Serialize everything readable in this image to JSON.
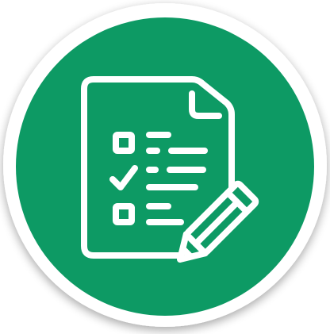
{
  "badge": {
    "icon": "checklist-with-pencil-icon",
    "colors": {
      "background": "#ffffff",
      "outer_ring": "#ffffff",
      "disc": "#0d9a64",
      "icon_stroke": "#ffffff",
      "shadow": "#000000"
    },
    "checklist_states": [
      "unchecked",
      "checked",
      "unchecked"
    ]
  }
}
